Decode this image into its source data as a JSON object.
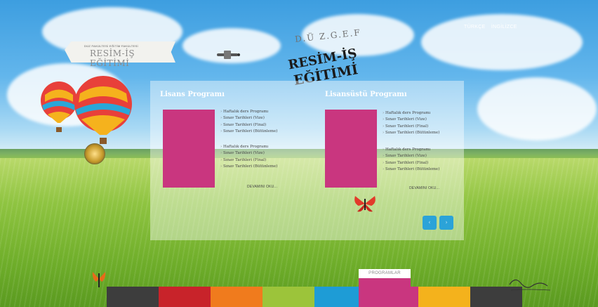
{
  "language_links": [
    "TÜRKÇE",
    "İNGİLİZCE"
  ],
  "banner": {
    "small_text": "DÜZ FAKÜLTESİ EĞİTİM FAKÜLTESİ",
    "title": "RESİM-İŞ EĞİTİMİ"
  },
  "logo": {
    "top": "D.Ü Z.G.E.F",
    "line1": "RESİM-İŞ",
    "line2": "EĞİTİMİ"
  },
  "columns": [
    {
      "title": "Lisans Programı",
      "group1": [
        "Haftalık ders Programı",
        "Sınav Tarihleri (Vize)",
        "Sınav Tarihleri (Final)",
        "Sınav Tarihleri (Bütünleme)"
      ],
      "group2": [
        "Haftalık ders Programı",
        "Sınav Tarihleri (Vize)",
        "Sınav Tarihleri (Final)",
        "Sınav Tarihleri (Bütünleme)"
      ],
      "more": "DEVAMINI OKU..."
    },
    {
      "title": "Lisansüstü Programı",
      "group1": [
        "Haftalık ders Programı",
        "Sınav Tarihleri (Vize)",
        "Sınav Tarihleri (Final)",
        "Sınav Tarihleri (Bütünleme)"
      ],
      "group2": [
        "Haftalık ders Programı",
        "Sınav Tarihleri (Vize)",
        "Sınav Tarihleri (Final)",
        "Sınav Tarihleri (Bütünleme)"
      ],
      "more": "DEVAMINI OKU..."
    }
  ],
  "nav": {
    "prev": "‹",
    "next": "›"
  },
  "bottom_tabs_colors": [
    "#3d3d3d",
    "#c8232a",
    "#f07b1d",
    "#9cc43a",
    "#1e9cd6",
    "#c9367f",
    "#f4b21c",
    "#3d3d3d"
  ],
  "active_tab_label": "PROGRAMLAR"
}
